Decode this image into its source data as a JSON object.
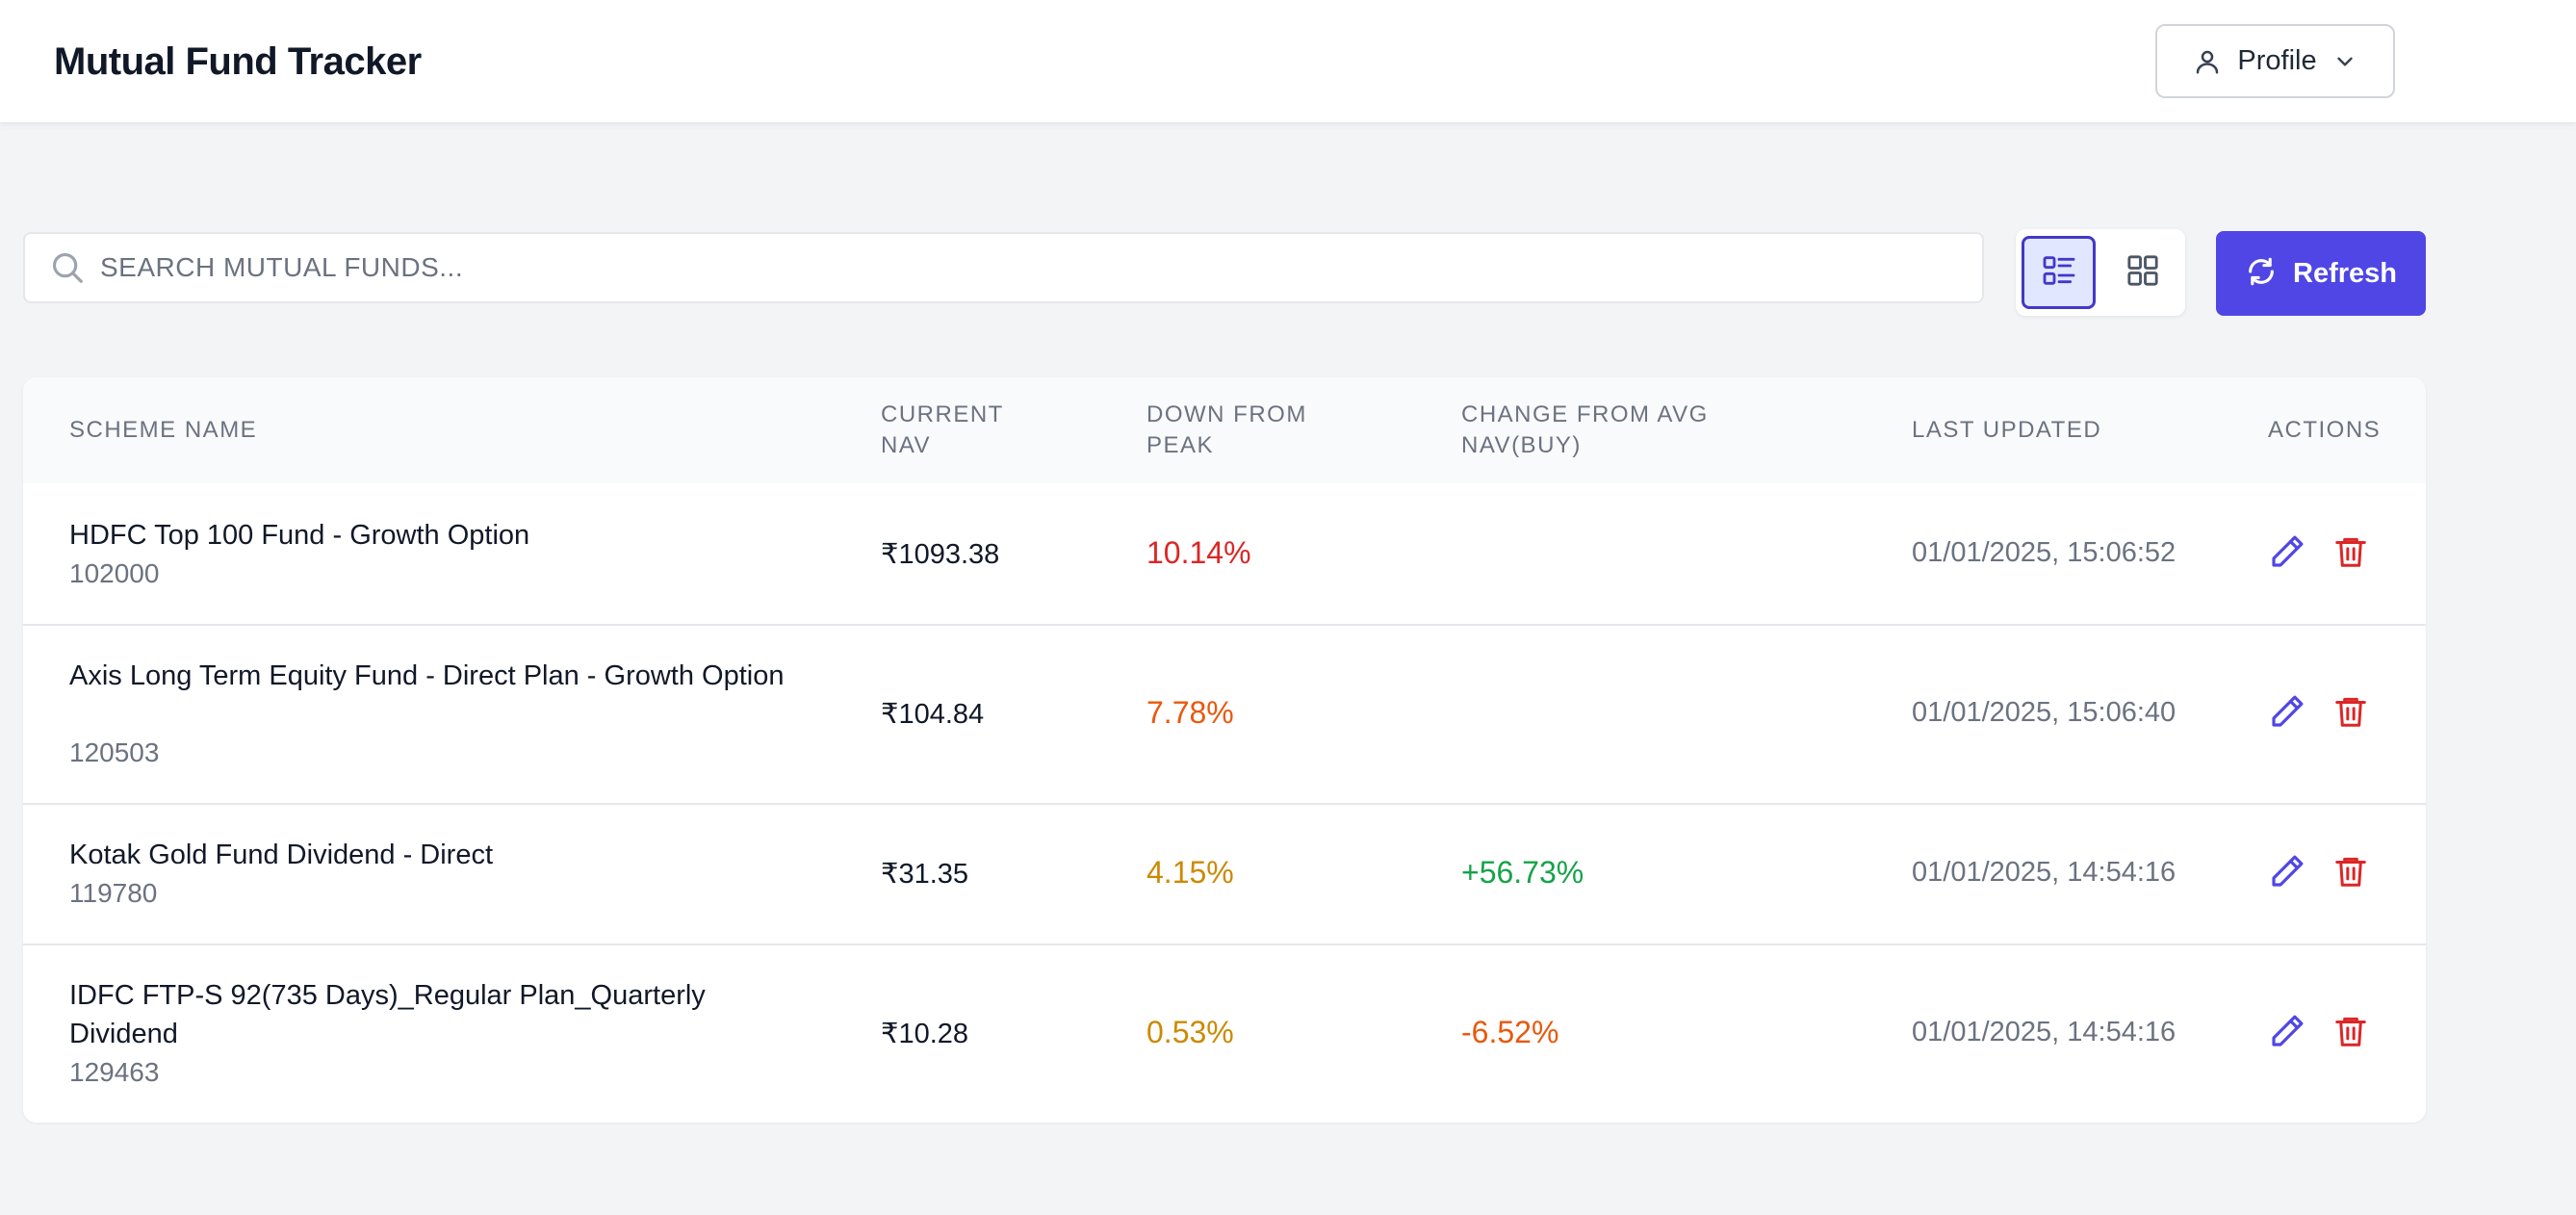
{
  "header": {
    "title": "Mutual Fund Tracker",
    "profile_label": "Profile"
  },
  "toolbar": {
    "search_placeholder": "SEARCH MUTUAL FUNDS...",
    "search_value": "",
    "view_modes": [
      "list",
      "grid"
    ],
    "active_view": "list",
    "refresh_label": "Refresh"
  },
  "table": {
    "columns": [
      "SCHEME NAME",
      "CURRENT NAV",
      "DOWN FROM PEAK",
      "CHANGE FROM AVG NAV(BUY)",
      "LAST UPDATED",
      "ACTIONS"
    ],
    "column_lines": [
      [
        "SCHEME NAME"
      ],
      [
        "CURRENT",
        "NAV"
      ],
      [
        "DOWN FROM",
        "PEAK"
      ],
      [
        "CHANGE FROM AVG",
        "NAV(BUY)"
      ],
      [
        "LAST UPDATED"
      ],
      [
        "ACTIONS"
      ]
    ],
    "rows": [
      {
        "name": "HDFC Top 100 Fund - Growth Option",
        "code": "102000",
        "nav": "₹1093.38",
        "down_from_peak": "10.14%",
        "down_color": "#dc2626",
        "change_from_avg": "",
        "change_color": "#16a34a",
        "last_updated": "01/01/2025, 15:06:52"
      },
      {
        "name": "Axis Long Term Equity Fund - Direct Plan - Growth Option",
        "code": "120503",
        "nav": "₹104.84",
        "down_from_peak": "7.78%",
        "down_color": "#ea580c",
        "change_from_avg": "",
        "change_color": "#16a34a",
        "last_updated": "01/01/2025, 15:06:40"
      },
      {
        "name": "Kotak Gold Fund Dividend - Direct",
        "code": "119780",
        "nav": "₹31.35",
        "down_from_peak": "4.15%",
        "down_color": "#ca8a04",
        "change_from_avg": "+56.73%",
        "change_color": "#16a34a",
        "last_updated": "01/01/2025, 14:54:16"
      },
      {
        "name": "IDFC FTP-S 92(735 Days)_Regular Plan_Quarterly Dividend",
        "code": "129463",
        "nav": "₹10.28",
        "down_from_peak": "0.53%",
        "down_color": "#ca8a04",
        "change_from_avg": "-6.52%",
        "change_color": "#ea580c",
        "last_updated": "01/01/2025, 14:54:16"
      }
    ],
    "row_actions": [
      "edit",
      "delete"
    ]
  },
  "colors": {
    "accent": "#4f46e5",
    "edit_icon": "#4f46e5",
    "delete_icon": "#dc2626",
    "page_background": "#f3f4f6"
  },
  "icons": {
    "profile": "user-icon",
    "profile_caret": "chevron-down-icon",
    "search": "search-icon",
    "list_view": "list-view-icon",
    "grid_view": "grid-view-icon",
    "refresh": "refresh-icon",
    "edit": "pencil-icon",
    "delete": "trash-icon"
  }
}
